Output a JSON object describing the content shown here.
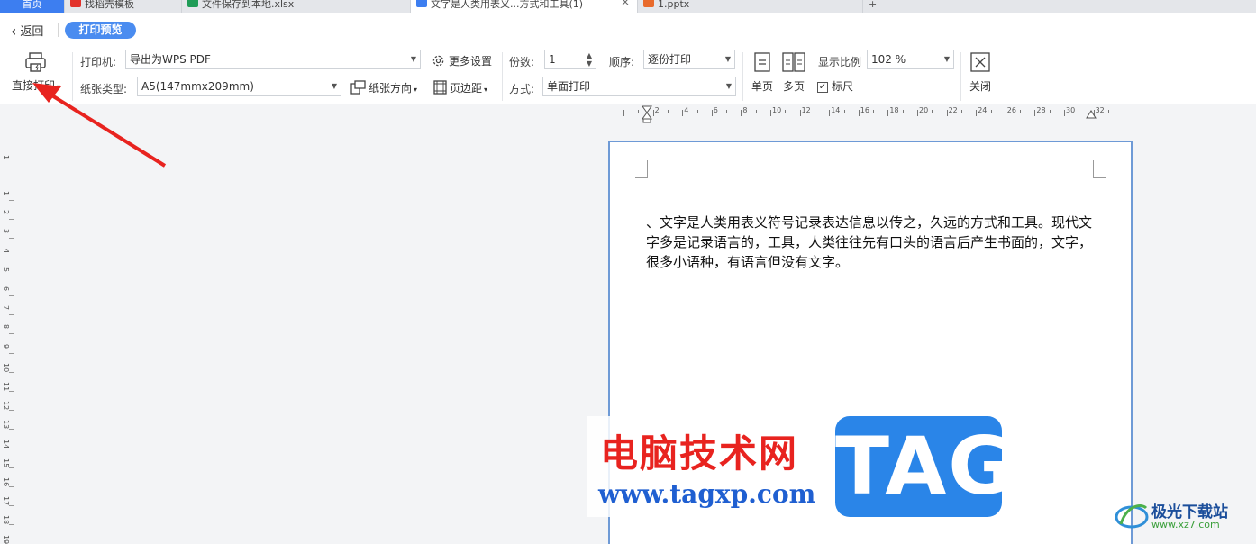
{
  "tabs": [
    {
      "label": "首页",
      "active": false,
      "home": true
    },
    {
      "label": "找稻壳模板",
      "active": false,
      "icon_color": "#e2322b"
    },
    {
      "label": "文件保存到本地.xlsx",
      "active": false,
      "icon_color": "#1f9c57"
    },
    {
      "label": "文字是人类用表义...方式和工具(1)",
      "active": true,
      "icon_color": "#3d7ef0"
    },
    {
      "label": "1.pptx",
      "active": false,
      "icon_color": "#e86a2b"
    }
  ],
  "topbar": {
    "back_label": "返回",
    "preview_label": "打印预览"
  },
  "toolbar": {
    "direct_print_label": "直接打印",
    "printer_label": "打印机:",
    "printer_value": "导出为WPS PDF",
    "more_settings_label": "更多设置",
    "paper_type_label": "纸张类型:",
    "paper_type_value": "A5(147mmx209mm)",
    "paper_orientation_label": "纸张方向",
    "margin_label": "页边距",
    "copies_label": "份数:",
    "copies_value": "1",
    "order_label": "顺序:",
    "order_value": "逐份打印",
    "mode_label": "方式:",
    "mode_value": "单面打印",
    "single_page_label": "单页",
    "multi_page_label": "多页",
    "zoom_label": "显示比例",
    "zoom_value": "102 %",
    "ruler_label": "标尺",
    "ruler_checked": true,
    "close_label": "关闭"
  },
  "ruler": {
    "h_numbers": [
      "2",
      "4",
      "6",
      "8",
      "10",
      "12",
      "14",
      "16",
      "18",
      "20",
      "22",
      "24",
      "26",
      "28",
      "30",
      "32"
    ],
    "v_numbers": [
      "1",
      "2",
      "3",
      "4",
      "5",
      "6",
      "7",
      "8",
      "9",
      "10",
      "11",
      "12",
      "13",
      "14",
      "15",
      "16",
      "17",
      "18",
      "19"
    ]
  },
  "document": {
    "text": "、文字是人类用表义符号记录表达信息以传之，久远的方式和工具。现代文字多是记录语言的，工具，人类往往先有口头的语言后产生书面的，文字，很多小语种，有语言但没有文字。"
  },
  "watermark": {
    "cn_text": "电脑技术网",
    "url_text": "www.tagxp.com",
    "tag_text": "TAG",
    "brand_name": "极光下载站",
    "brand_url": "www.xz7.com"
  },
  "colors": {
    "accent": "#4a8cf0",
    "page_border": "#6e9ad6",
    "arrow": "#e8231f"
  }
}
